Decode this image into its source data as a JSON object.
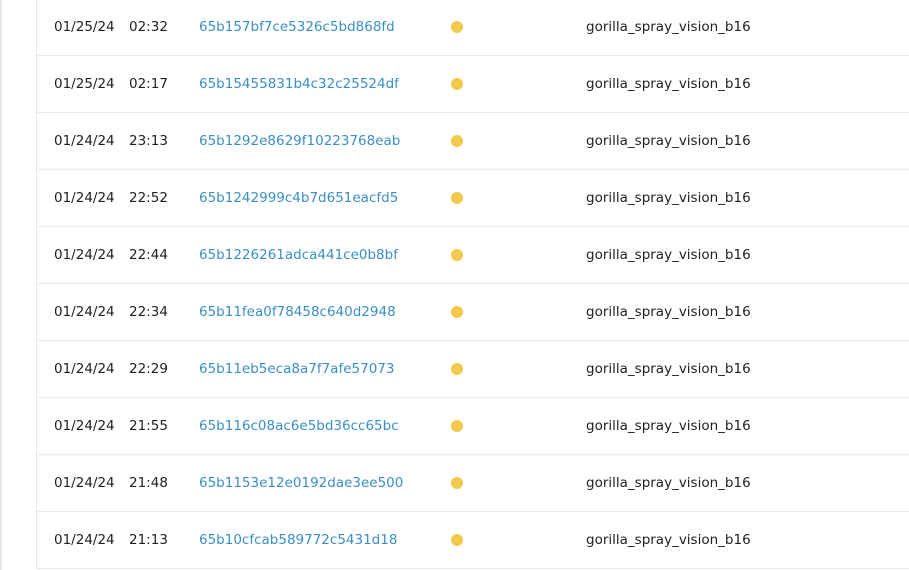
{
  "status_color": "#f2c94c",
  "rows": [
    {
      "date": "01/25/24",
      "time": "02:32",
      "id": "65b157bf7ce5326c5bd868fd",
      "status_icon": "yellow-dot",
      "name": "gorilla_spray_vision_b16"
    },
    {
      "date": "01/25/24",
      "time": "02:17",
      "id": "65b15455831b4c32c25524df",
      "status_icon": "yellow-dot",
      "name": "gorilla_spray_vision_b16"
    },
    {
      "date": "01/24/24",
      "time": "23:13",
      "id": "65b1292e8629f10223768eab",
      "status_icon": "yellow-dot",
      "name": "gorilla_spray_vision_b16"
    },
    {
      "date": "01/24/24",
      "time": "22:52",
      "id": "65b1242999c4b7d651eacfd5",
      "status_icon": "yellow-dot",
      "name": "gorilla_spray_vision_b16"
    },
    {
      "date": "01/24/24",
      "time": "22:44",
      "id": "65b1226261adca441ce0b8bf",
      "status_icon": "yellow-dot",
      "name": "gorilla_spray_vision_b16"
    },
    {
      "date": "01/24/24",
      "time": "22:34",
      "id": "65b11fea0f78458c640d2948",
      "status_icon": "yellow-dot",
      "name": "gorilla_spray_vision_b16"
    },
    {
      "date": "01/24/24",
      "time": "22:29",
      "id": "65b11eb5eca8a7f7afe57073",
      "status_icon": "yellow-dot",
      "name": "gorilla_spray_vision_b16"
    },
    {
      "date": "01/24/24",
      "time": "21:55",
      "id": "65b116c08ac6e5bd36cc65bc",
      "status_icon": "yellow-dot",
      "name": "gorilla_spray_vision_b16"
    },
    {
      "date": "01/24/24",
      "time": "21:48",
      "id": "65b1153e12e0192dae3ee500",
      "status_icon": "yellow-dot",
      "name": "gorilla_spray_vision_b16"
    },
    {
      "date": "01/24/24",
      "time": "21:13",
      "id": "65b10cfcab589772c5431d18",
      "status_icon": "yellow-dot",
      "name": "gorilla_spray_vision_b16"
    }
  ]
}
